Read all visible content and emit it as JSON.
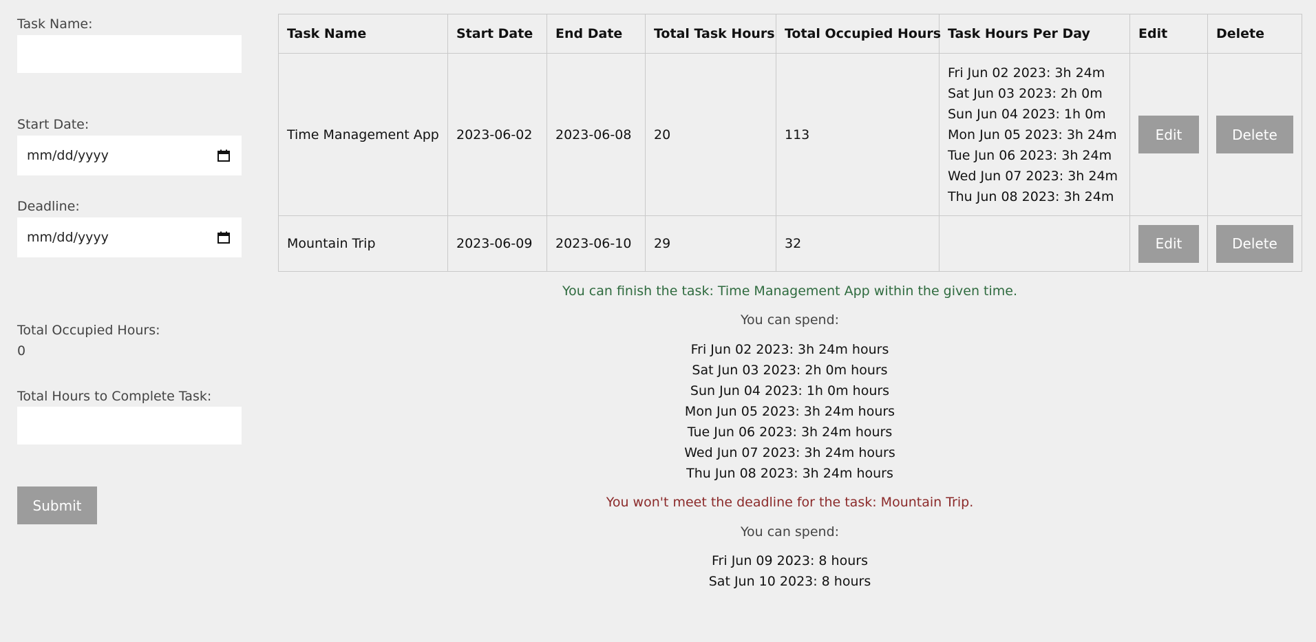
{
  "form": {
    "task_name_label": "Task Name:",
    "start_date_label": "Start Date:",
    "start_date_placeholder": "mm/dd/yyyy",
    "deadline_label": "Deadline:",
    "deadline_placeholder": "mm/dd/yyyy",
    "total_occupied_label": "Total Occupied Hours:",
    "total_occupied_value": "0",
    "total_hours_label": "Total Hours to Complete Task:",
    "submit_label": "Submit"
  },
  "table": {
    "headers": {
      "task_name": "Task Name",
      "start_date": "Start Date",
      "end_date": "End Date",
      "total_task_hours": "Total Task Hours",
      "total_occupied_hours": "Total Occupied Hours",
      "task_hours_per_day": "Task Hours Per Day",
      "edit": "Edit",
      "delete": "Delete"
    },
    "rows": [
      {
        "task_name": "Time Management App",
        "start_date": "2023-06-02",
        "end_date": "2023-06-08",
        "total_task_hours": "20",
        "total_occupied_hours": "113",
        "hours_per_day": [
          "Fri Jun 02 2023: 3h 24m",
          "Sat Jun 03 2023: 2h 0m",
          "Sun Jun 04 2023: 1h 0m",
          "Mon Jun 05 2023: 3h 24m",
          "Tue Jun 06 2023: 3h 24m",
          "Wed Jun 07 2023: 3h 24m",
          "Thu Jun 08 2023: 3h 24m"
        ],
        "edit_label": "Edit",
        "delete_label": "Delete"
      },
      {
        "task_name": "Mountain Trip",
        "start_date": "2023-06-09",
        "end_date": "2023-06-10",
        "total_task_hours": "29",
        "total_occupied_hours": "32",
        "hours_per_day": [],
        "edit_label": "Edit",
        "delete_label": "Delete"
      }
    ]
  },
  "results": {
    "success_message": "You can finish the task: Time Management App within the given time.",
    "spend_label_1": "You can spend:",
    "spend_list_1": [
      "Fri Jun 02 2023: 3h 24m hours",
      "Sat Jun 03 2023: 2h 0m hours",
      "Sun Jun 04 2023: 1h 0m hours",
      "Mon Jun 05 2023: 3h 24m hours",
      "Tue Jun 06 2023: 3h 24m hours",
      "Wed Jun 07 2023: 3h 24m hours",
      "Thu Jun 08 2023: 3h 24m hours"
    ],
    "fail_message": "You won't meet the deadline for the task: Mountain Trip.",
    "spend_label_2": "You can spend:",
    "spend_list_2": [
      "Fri Jun 09 2023: 8 hours",
      "Sat Jun 10 2023: 8 hours"
    ]
  },
  "colors": {
    "background": "#efefef",
    "button": "#9c9c9c",
    "success_text": "#2f6b3f",
    "fail_text": "#8b2a2a"
  },
  "icons": {
    "date_picker": "calendar-icon"
  }
}
